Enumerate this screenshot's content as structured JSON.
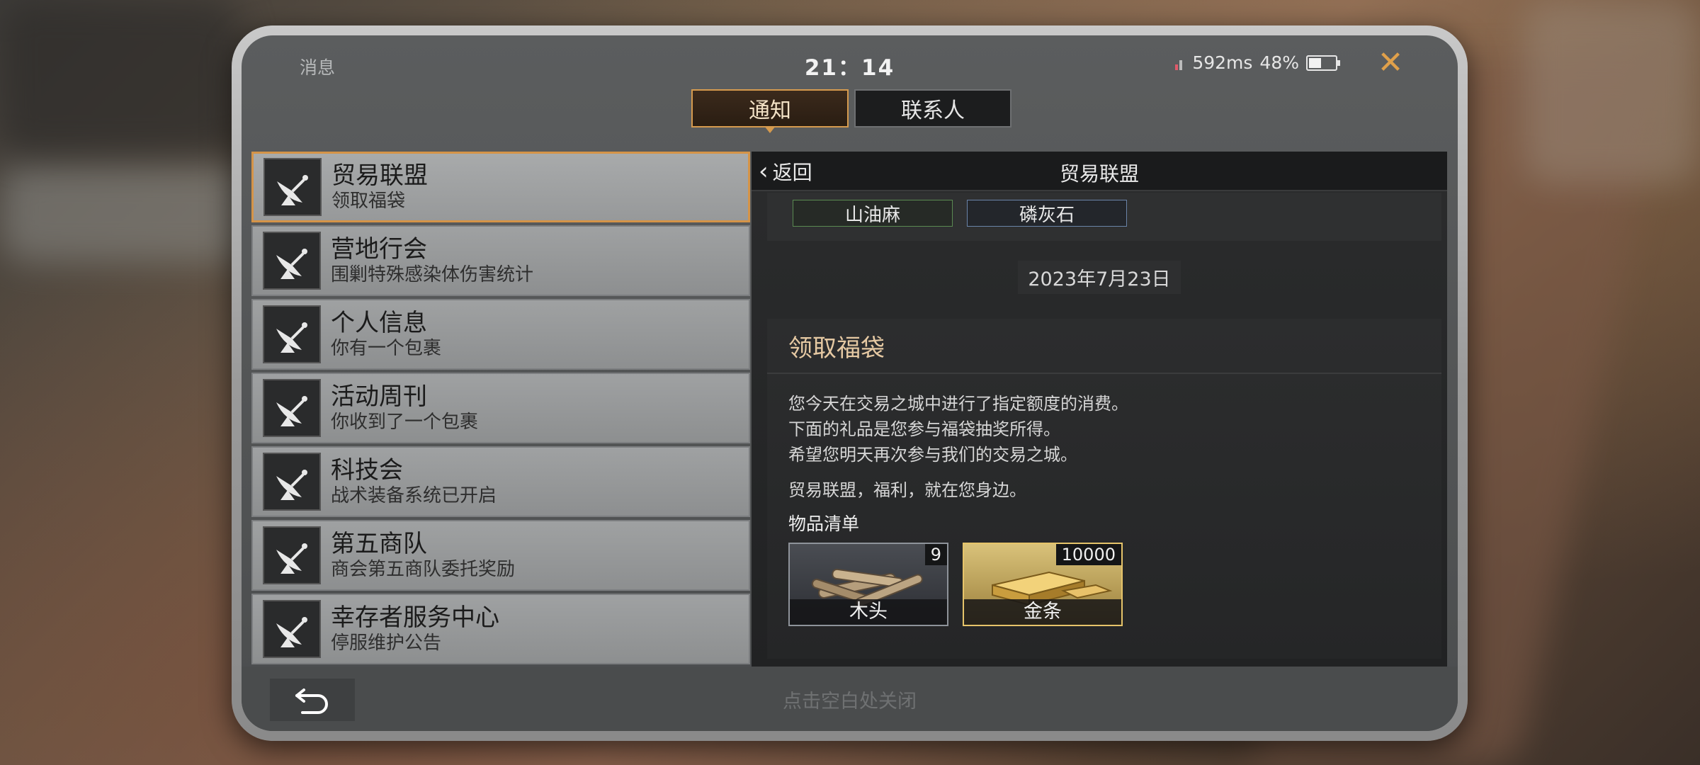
{
  "status": {
    "title": "消息",
    "time": "21：14",
    "ping": "592ms",
    "battery": "48%"
  },
  "tabs": [
    {
      "label": "通知",
      "active": true
    },
    {
      "label": "联系人",
      "active": false
    }
  ],
  "mail_list": [
    {
      "title": "贸易联盟",
      "subtitle": "领取福袋",
      "icon": "satellite-dish-icon"
    },
    {
      "title": "营地行会",
      "subtitle": "围剿特殊感染体伤害统计",
      "icon": "satellite-dish-icon"
    },
    {
      "title": "个人信息",
      "subtitle": "你有一个包裹",
      "icon": "satellite-dish-icon"
    },
    {
      "title": "活动周刊",
      "subtitle": "你收到了一个包裹",
      "icon": "satellite-dish-icon"
    },
    {
      "title": "科技会",
      "subtitle": "战术装备系统已开启",
      "icon": "satellite-dish-icon"
    },
    {
      "title": "第五商队",
      "subtitle": "商会第五商队委托奖励",
      "icon": "satellite-dish-icon"
    },
    {
      "title": "幸存者服务中心",
      "subtitle": "停服维护公告",
      "icon": "satellite-dish-icon"
    }
  ],
  "panel": {
    "back_label": "返回",
    "title": "贸易联盟",
    "prev_chips": [
      "山油麻",
      "磷灰石"
    ],
    "date": "2023年7月23日",
    "mail_title": "领取福袋",
    "body": [
      "您今天在交易之城中进行了指定额度的消费。",
      "下面的礼品是您参与福袋抽奖所得。",
      "希望您明天再次参与我们的交易之城。"
    ],
    "signoff": "贸易联盟，福利，就在您身边。",
    "items_label": "物品清单",
    "rewards": [
      {
        "name": "木头",
        "count": "9"
      },
      {
        "name": "金条",
        "count": "10000"
      }
    ]
  },
  "bottom": {
    "close_hint": "点击空白处关闭"
  },
  "colors": {
    "accent": "#d59a4e",
    "close": "#e0a04a",
    "mail_title": "#e6c9a3"
  }
}
